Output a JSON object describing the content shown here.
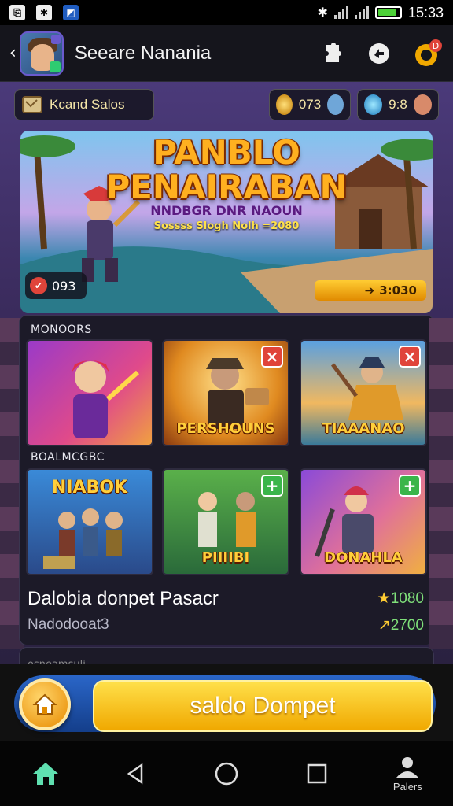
{
  "status_bar": {
    "time": "15:33",
    "battery_level": 0.9,
    "colors": {
      "battery": "#4cd137"
    }
  },
  "header": {
    "title": "Seeare Nanania",
    "icons": [
      "back-chevron-icon",
      "puzzle-icon",
      "share-icon",
      "notification-icon"
    ]
  },
  "resources": {
    "left_label": "Kcand Salos",
    "counter1": "073",
    "counter2": "9:8"
  },
  "banner": {
    "title_line1": "PANBLO",
    "title_line2": "PENAIRABAN",
    "subtitle": "NNDBGR DNR NAOUN",
    "subtitle2": "Sossss Slogh Nolh =2080",
    "left_badge": "093",
    "right_badge": "3:030"
  },
  "games": {
    "section1_label": "MONOORS",
    "section2_label": "BOALMCGBC",
    "row1": [
      {
        "caption": "",
        "action": ""
      },
      {
        "caption": "PERSHOUNS",
        "action": "close"
      },
      {
        "caption": "TIAAANAO",
        "action": "close"
      }
    ],
    "row2": [
      {
        "caption": "NIABOK",
        "action": ""
      },
      {
        "caption": "PIIIIBI",
        "action": "add"
      },
      {
        "caption": "DONAHLA",
        "action": "add"
      }
    ],
    "summary_title": "Dalobia donpet Pasacr",
    "summary_sub": "Nadodooat3",
    "value1": "1080",
    "value2": "2700",
    "next_section_label": "osneamsuli"
  },
  "action_bar": {
    "button_label": "saldo Dompet",
    "colors": {
      "primary": "#f0a800",
      "track": "#2a66c8"
    }
  },
  "nav": {
    "profile_label": "Palers",
    "colors": {
      "home": "#5fe0b0"
    }
  }
}
